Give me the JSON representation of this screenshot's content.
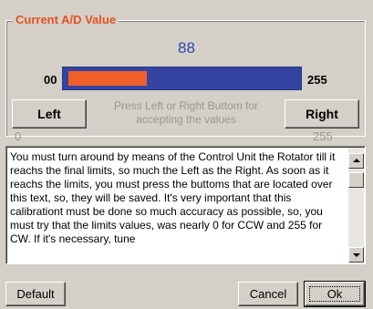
{
  "group": {
    "title": "Current A/D Value"
  },
  "ad_value": "88",
  "bar": {
    "min_label": "00",
    "max_label": "255",
    "fill_fraction": 0.345,
    "colors": {
      "track": "#3444a0",
      "fill": "#f0602a"
    }
  },
  "buttons": {
    "left_label": "Left",
    "right_label": "Right",
    "default_label": "Default",
    "cancel_label": "Cancel",
    "ok_label": "Ok"
  },
  "hint": "Press Left or Right Buttom for accepting the values",
  "raw": {
    "left_value": "0",
    "right_value": "255"
  },
  "instructions": "You must turn around by means of the Control Unit the Rotator till it reachs the final limits, so much the Left as the Right. As soon as it reachs the limits, you must press the buttoms that are located over this text, so, they will be saved. It's very important that this calibrationt must be done so much accuracy as possible, so, you must try that the limits values, was nearly 0 for CCW and 255 for CW. If it's necessary, tune",
  "scrollbar": {
    "up_icon": "triangle-up",
    "down_icon": "triangle-down"
  }
}
